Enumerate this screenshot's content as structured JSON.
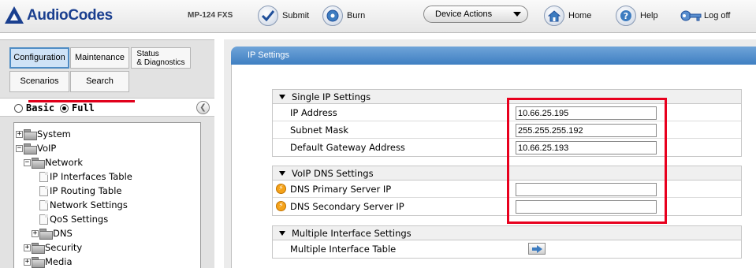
{
  "topbar": {
    "logo_text": "AudioCodes",
    "model": "MP-124 FXS",
    "submit_label": "Submit",
    "burn_label": "Burn",
    "device_actions_label": "Device Actions",
    "home_label": "Home",
    "help_label": "Help",
    "logoff_label": "Log off"
  },
  "left_panel": {
    "tabs": {
      "configuration": "Configuration",
      "maintenance": "Maintenance",
      "status_line1": "Status",
      "status_line2": "& Diagnostics",
      "scenarios": "Scenarios",
      "search": "Search"
    },
    "mode": {
      "basic": "Basic",
      "full": "Full",
      "selected": "Full"
    },
    "tree": [
      {
        "label": "System",
        "level": 0,
        "type": "folder",
        "expanded": false
      },
      {
        "label": "VoIP",
        "level": 0,
        "type": "folder",
        "expanded": true
      },
      {
        "label": "Network",
        "level": 1,
        "type": "folder",
        "expanded": true
      },
      {
        "label": "IP Interfaces Table",
        "level": 2,
        "type": "page",
        "selected": true
      },
      {
        "label": "IP Routing Table",
        "level": 2,
        "type": "page"
      },
      {
        "label": "Network Settings",
        "level": 2,
        "type": "page"
      },
      {
        "label": "QoS Settings",
        "level": 2,
        "type": "page"
      },
      {
        "label": "DNS",
        "level": 2,
        "type": "folder",
        "expanded": false
      },
      {
        "label": "Security",
        "level": 1,
        "type": "folder",
        "expanded": false
      },
      {
        "label": "Media",
        "level": 1,
        "type": "folder",
        "expanded": false
      }
    ]
  },
  "page": {
    "title": "IP Settings",
    "groups": {
      "single_ip": {
        "title": "Single IP Settings",
        "ip_address_label": "IP Address",
        "ip_address_value": "10.66.25.195",
        "subnet_mask_label": "Subnet Mask",
        "subnet_mask_value": "255.255.255.192",
        "gateway_label": "Default Gateway Address",
        "gateway_value": "10.66.25.193"
      },
      "voip_dns": {
        "title": "VoIP DNS Settings",
        "primary_label": "DNS Primary Server IP",
        "primary_value": "",
        "secondary_label": "DNS Secondary Server IP",
        "secondary_value": ""
      },
      "multiple_interface": {
        "title": "Multiple Interface Settings",
        "table_label": "Multiple Interface Table"
      }
    }
  },
  "colors": {
    "brand": "#1a3f8f",
    "header_blue": "#4f8cc4",
    "highlight_red": "#e8001e",
    "icon_orange": "#f5a31a"
  }
}
